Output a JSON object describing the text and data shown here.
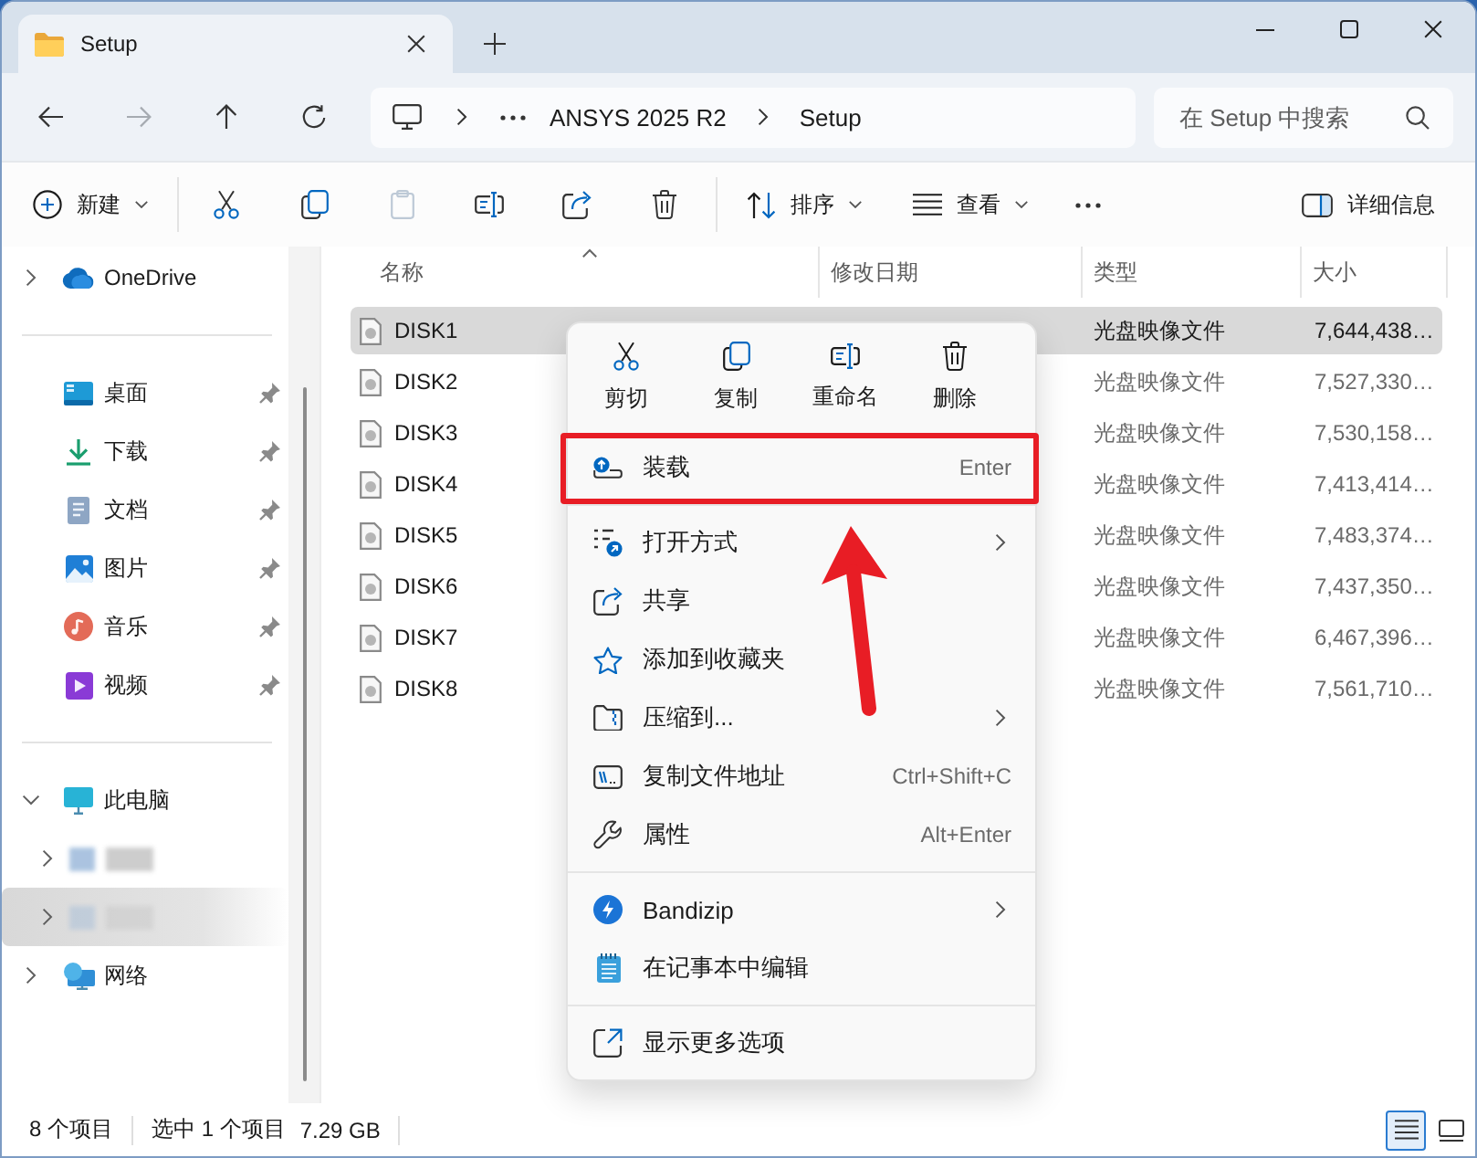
{
  "window": {
    "tabs": [
      {
        "label": "Setup",
        "selected": true
      }
    ]
  },
  "navigation": {
    "back": {
      "disabled": false
    },
    "forward": {
      "disabled": true
    },
    "up": {
      "disabled": false
    }
  },
  "address_bar": {
    "path": [
      "ANSYS 2025 R2",
      "Setup"
    ]
  },
  "search": {
    "placeholder": "在 Setup 中搜索"
  },
  "toolbar": {
    "new_button": {
      "label": "新建"
    },
    "actions": [
      {
        "disabled": false
      },
      {
        "disabled": false
      },
      {
        "disabled": true
      },
      {
        "disabled": false
      },
      {
        "disabled": false
      },
      {
        "disabled": false
      }
    ],
    "sort_button": {
      "label": "排序"
    },
    "view_button": {
      "label": "查看"
    },
    "details_button": {
      "label": "详细信息"
    }
  },
  "sidebar": {
    "sections": [
      {
        "items": [
          {
            "label": "OneDrive",
            "expanded": false,
            "pinned": false,
            "selected": false
          }
        ]
      },
      {
        "items": [
          {
            "label": "桌面",
            "pinned": true,
            "selected": false
          },
          {
            "label": "下载",
            "pinned": true,
            "selected": false
          },
          {
            "label": "文档",
            "pinned": true,
            "selected": false
          },
          {
            "label": "图片",
            "pinned": true,
            "selected": false
          },
          {
            "label": "音乐",
            "pinned": true,
            "selected": false
          },
          {
            "label": "视频",
            "pinned": true,
            "selected": false
          }
        ]
      },
      {
        "items": [
          {
            "label": "此电脑",
            "expanded": true,
            "pinned": false,
            "selected": false,
            "children": [
              {
                "expanded": false,
                "pinned": false,
                "selected": false
              },
              {
                "expanded": false,
                "pinned": false,
                "selected": true
              }
            ]
          },
          {
            "label": "网络",
            "expanded": false,
            "pinned": false,
            "selected": false
          }
        ]
      }
    ]
  },
  "file_list": {
    "columns": [
      {
        "label": "名称",
        "sorted": true
      },
      {
        "label": "修改日期",
        "sorted": false
      },
      {
        "label": "类型",
        "sorted": false
      },
      {
        "label": "大小",
        "sorted": false
      }
    ],
    "rows": [
      {
        "name": "DISK1",
        "type": "光盘映像文件",
        "size": "7,644,438…",
        "selected": true
      },
      {
        "name": "DISK2",
        "type": "光盘映像文件",
        "size": "7,527,330…",
        "selected": false
      },
      {
        "name": "DISK3",
        "type": "光盘映像文件",
        "size": "7,530,158…",
        "selected": false
      },
      {
        "name": "DISK4",
        "type": "光盘映像文件",
        "size": "7,413,414…",
        "selected": false
      },
      {
        "name": "DISK5",
        "type": "光盘映像文件",
        "size": "7,483,374…",
        "selected": false
      },
      {
        "name": "DISK6",
        "type": "光盘映像文件",
        "size": "7,437,350…",
        "selected": false
      },
      {
        "name": "DISK7",
        "type": "光盘映像文件",
        "size": "6,467,396…",
        "selected": false
      },
      {
        "name": "DISK8",
        "type": "光盘映像文件",
        "size": "7,561,710…",
        "selected": false
      }
    ]
  },
  "context_menu": {
    "quick_actions": [
      {
        "label": "剪切"
      },
      {
        "label": "复制"
      },
      {
        "label": "重命名"
      },
      {
        "label": "删除"
      }
    ],
    "groups": [
      {
        "items": [
          {
            "label": "装载",
            "shortcut": "Enter",
            "submenu": false,
            "highlighted": true
          }
        ]
      },
      {
        "items": [
          {
            "label": "打开方式",
            "submenu": true,
            "highlighted": false
          },
          {
            "label": "共享",
            "submenu": false,
            "highlighted": false
          },
          {
            "label": "添加到收藏夹",
            "submenu": false,
            "highlighted": false
          },
          {
            "label": "压缩到...",
            "submenu": true,
            "highlighted": false
          },
          {
            "label": "复制文件地址",
            "shortcut": "Ctrl+Shift+C",
            "submenu": false,
            "highlighted": false
          },
          {
            "label": "属性",
            "shortcut": "Alt+Enter",
            "submenu": false,
            "highlighted": false
          }
        ]
      },
      {
        "items": [
          {
            "label": "Bandizip",
            "submenu": true,
            "highlighted": false
          },
          {
            "label": "在记事本中编辑",
            "submenu": false,
            "highlighted": false
          }
        ]
      },
      {
        "items": [
          {
            "label": "显示更多选项",
            "submenu": false,
            "highlighted": false
          }
        ]
      }
    ]
  },
  "status_bar": {
    "item_count": "8 个项目",
    "selection": "选中 1 个项目",
    "selection_size": "7.29 GB",
    "views": [
      {
        "selected": true
      },
      {
        "selected": false
      }
    ]
  }
}
